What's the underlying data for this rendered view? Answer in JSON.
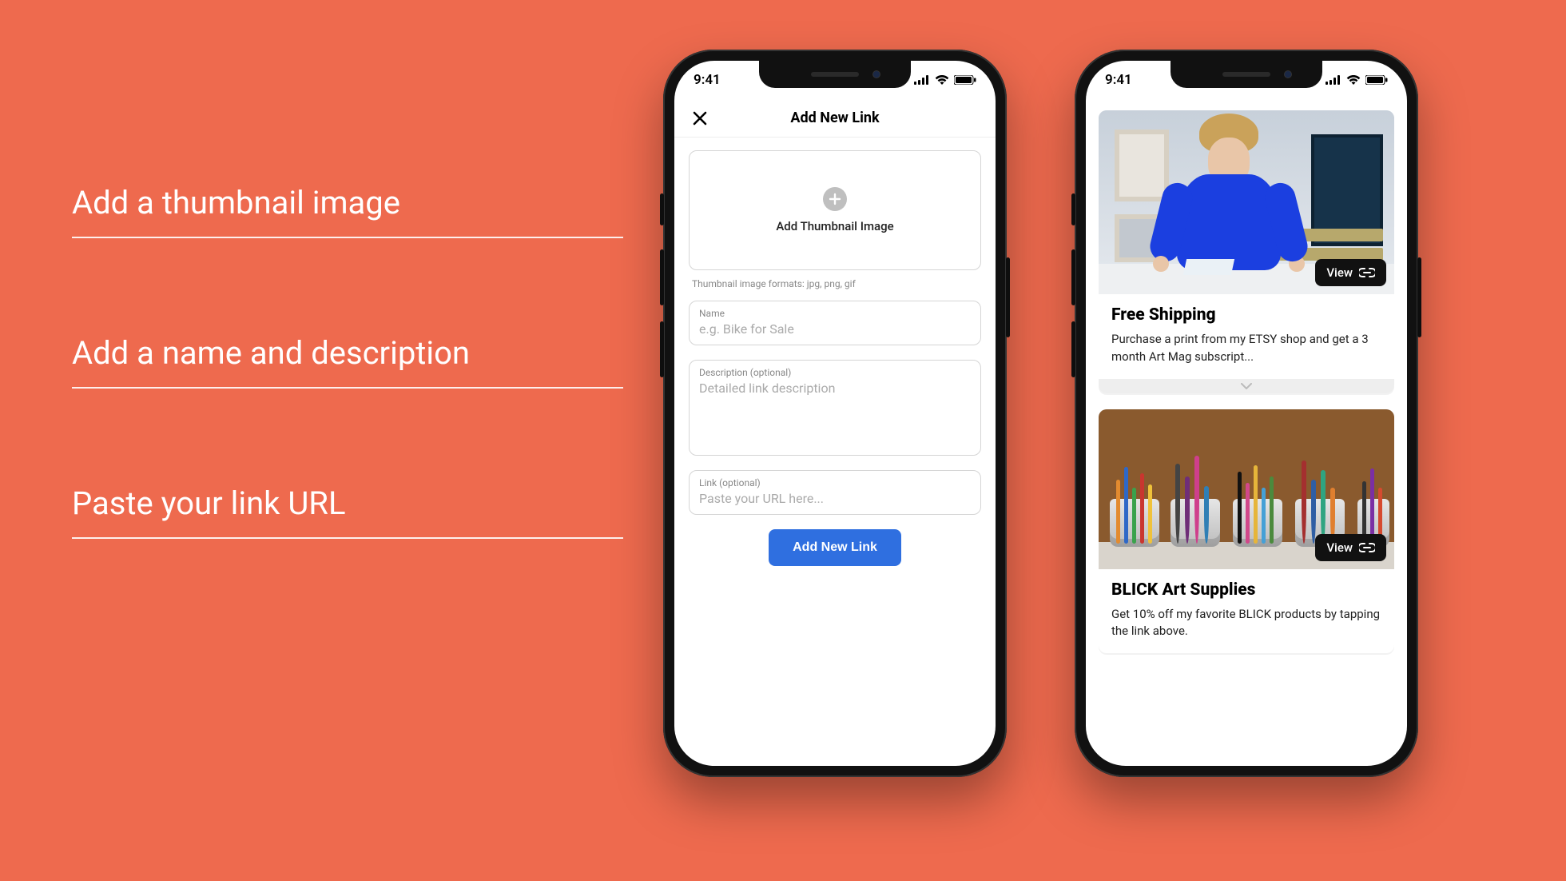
{
  "captions": {
    "c1": "Add a thumbnail image",
    "c2": "Add a name and description",
    "c3": "Paste your link URL"
  },
  "status": {
    "time": "9:41"
  },
  "screen1": {
    "title": "Add New Link",
    "thumb_label": "Add Thumbnail Image",
    "thumb_hint": "Thumbnail image formats: jpg, png, gif",
    "name_label": "Name",
    "name_placeholder": "e.g. Bike for Sale",
    "desc_label": "Description (optional)",
    "desc_placeholder": "Detailed link description",
    "link_label": "Link (optional)",
    "link_placeholder": "Paste your URL here...",
    "submit": "Add New Link"
  },
  "screen2": {
    "view_label": "View",
    "card1": {
      "title": "Free Shipping",
      "desc": "Purchase a print from my ETSY shop and get a 3 month Art Mag subscript..."
    },
    "card2": {
      "title": "BLICK Art Supplies",
      "desc": "Get 10% off my favorite BLICK products by tapping the link above."
    }
  }
}
